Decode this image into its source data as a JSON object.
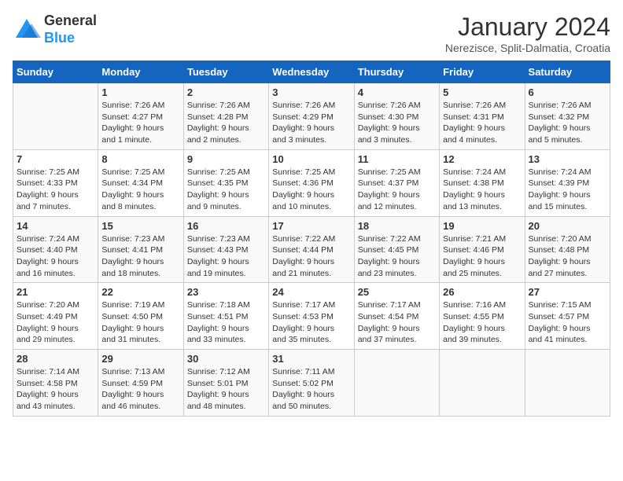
{
  "header": {
    "logo_general": "General",
    "logo_blue": "Blue",
    "title": "January 2024",
    "subtitle": "Nerezisce, Split-Dalmatia, Croatia"
  },
  "days_of_week": [
    "Sunday",
    "Monday",
    "Tuesday",
    "Wednesday",
    "Thursday",
    "Friday",
    "Saturday"
  ],
  "weeks": [
    [
      {
        "day": "",
        "info": ""
      },
      {
        "day": "1",
        "info": "Sunrise: 7:26 AM\nSunset: 4:27 PM\nDaylight: 9 hours\nand 1 minute."
      },
      {
        "day": "2",
        "info": "Sunrise: 7:26 AM\nSunset: 4:28 PM\nDaylight: 9 hours\nand 2 minutes."
      },
      {
        "day": "3",
        "info": "Sunrise: 7:26 AM\nSunset: 4:29 PM\nDaylight: 9 hours\nand 3 minutes."
      },
      {
        "day": "4",
        "info": "Sunrise: 7:26 AM\nSunset: 4:30 PM\nDaylight: 9 hours\nand 3 minutes."
      },
      {
        "day": "5",
        "info": "Sunrise: 7:26 AM\nSunset: 4:31 PM\nDaylight: 9 hours\nand 4 minutes."
      },
      {
        "day": "6",
        "info": "Sunrise: 7:26 AM\nSunset: 4:32 PM\nDaylight: 9 hours\nand 5 minutes."
      }
    ],
    [
      {
        "day": "7",
        "info": "Sunrise: 7:25 AM\nSunset: 4:33 PM\nDaylight: 9 hours\nand 7 minutes."
      },
      {
        "day": "8",
        "info": "Sunrise: 7:25 AM\nSunset: 4:34 PM\nDaylight: 9 hours\nand 8 minutes."
      },
      {
        "day": "9",
        "info": "Sunrise: 7:25 AM\nSunset: 4:35 PM\nDaylight: 9 hours\nand 9 minutes."
      },
      {
        "day": "10",
        "info": "Sunrise: 7:25 AM\nSunset: 4:36 PM\nDaylight: 9 hours\nand 10 minutes."
      },
      {
        "day": "11",
        "info": "Sunrise: 7:25 AM\nSunset: 4:37 PM\nDaylight: 9 hours\nand 12 minutes."
      },
      {
        "day": "12",
        "info": "Sunrise: 7:24 AM\nSunset: 4:38 PM\nDaylight: 9 hours\nand 13 minutes."
      },
      {
        "day": "13",
        "info": "Sunrise: 7:24 AM\nSunset: 4:39 PM\nDaylight: 9 hours\nand 15 minutes."
      }
    ],
    [
      {
        "day": "14",
        "info": "Sunrise: 7:24 AM\nSunset: 4:40 PM\nDaylight: 9 hours\nand 16 minutes."
      },
      {
        "day": "15",
        "info": "Sunrise: 7:23 AM\nSunset: 4:41 PM\nDaylight: 9 hours\nand 18 minutes."
      },
      {
        "day": "16",
        "info": "Sunrise: 7:23 AM\nSunset: 4:43 PM\nDaylight: 9 hours\nand 19 minutes."
      },
      {
        "day": "17",
        "info": "Sunrise: 7:22 AM\nSunset: 4:44 PM\nDaylight: 9 hours\nand 21 minutes."
      },
      {
        "day": "18",
        "info": "Sunrise: 7:22 AM\nSunset: 4:45 PM\nDaylight: 9 hours\nand 23 minutes."
      },
      {
        "day": "19",
        "info": "Sunrise: 7:21 AM\nSunset: 4:46 PM\nDaylight: 9 hours\nand 25 minutes."
      },
      {
        "day": "20",
        "info": "Sunrise: 7:20 AM\nSunset: 4:48 PM\nDaylight: 9 hours\nand 27 minutes."
      }
    ],
    [
      {
        "day": "21",
        "info": "Sunrise: 7:20 AM\nSunset: 4:49 PM\nDaylight: 9 hours\nand 29 minutes."
      },
      {
        "day": "22",
        "info": "Sunrise: 7:19 AM\nSunset: 4:50 PM\nDaylight: 9 hours\nand 31 minutes."
      },
      {
        "day": "23",
        "info": "Sunrise: 7:18 AM\nSunset: 4:51 PM\nDaylight: 9 hours\nand 33 minutes."
      },
      {
        "day": "24",
        "info": "Sunrise: 7:17 AM\nSunset: 4:53 PM\nDaylight: 9 hours\nand 35 minutes."
      },
      {
        "day": "25",
        "info": "Sunrise: 7:17 AM\nSunset: 4:54 PM\nDaylight: 9 hours\nand 37 minutes."
      },
      {
        "day": "26",
        "info": "Sunrise: 7:16 AM\nSunset: 4:55 PM\nDaylight: 9 hours\nand 39 minutes."
      },
      {
        "day": "27",
        "info": "Sunrise: 7:15 AM\nSunset: 4:57 PM\nDaylight: 9 hours\nand 41 minutes."
      }
    ],
    [
      {
        "day": "28",
        "info": "Sunrise: 7:14 AM\nSunset: 4:58 PM\nDaylight: 9 hours\nand 43 minutes."
      },
      {
        "day": "29",
        "info": "Sunrise: 7:13 AM\nSunset: 4:59 PM\nDaylight: 9 hours\nand 46 minutes."
      },
      {
        "day": "30",
        "info": "Sunrise: 7:12 AM\nSunset: 5:01 PM\nDaylight: 9 hours\nand 48 minutes."
      },
      {
        "day": "31",
        "info": "Sunrise: 7:11 AM\nSunset: 5:02 PM\nDaylight: 9 hours\nand 50 minutes."
      },
      {
        "day": "",
        "info": ""
      },
      {
        "day": "",
        "info": ""
      },
      {
        "day": "",
        "info": ""
      }
    ]
  ]
}
